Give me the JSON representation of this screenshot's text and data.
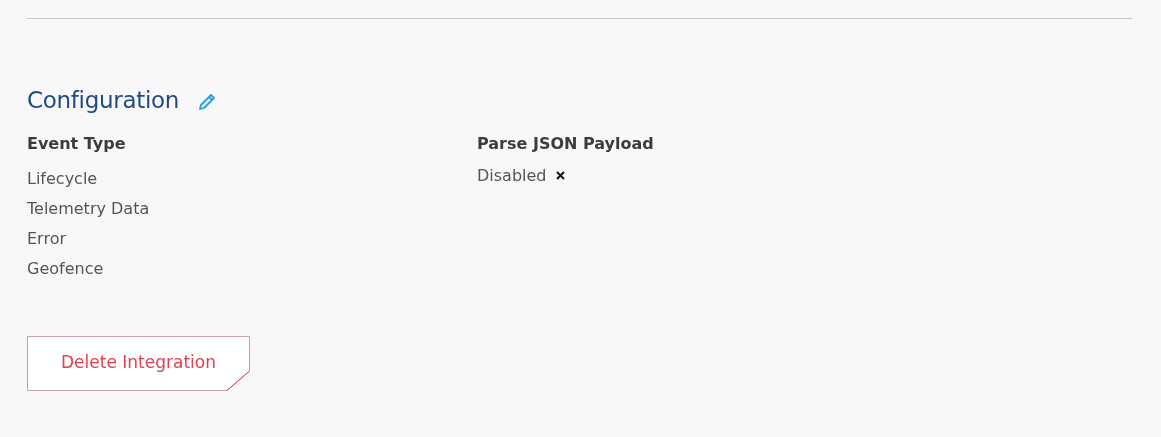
{
  "section": {
    "title": "Configuration"
  },
  "event_type": {
    "label": "Event Type",
    "values": [
      "Lifecycle",
      "Telemetry Data",
      "Error",
      "Geofence"
    ]
  },
  "parse_json_payload": {
    "label": "Parse JSON Payload",
    "value": "Disabled",
    "enabled": false
  },
  "delete_button": {
    "label": "Delete Integration"
  }
}
